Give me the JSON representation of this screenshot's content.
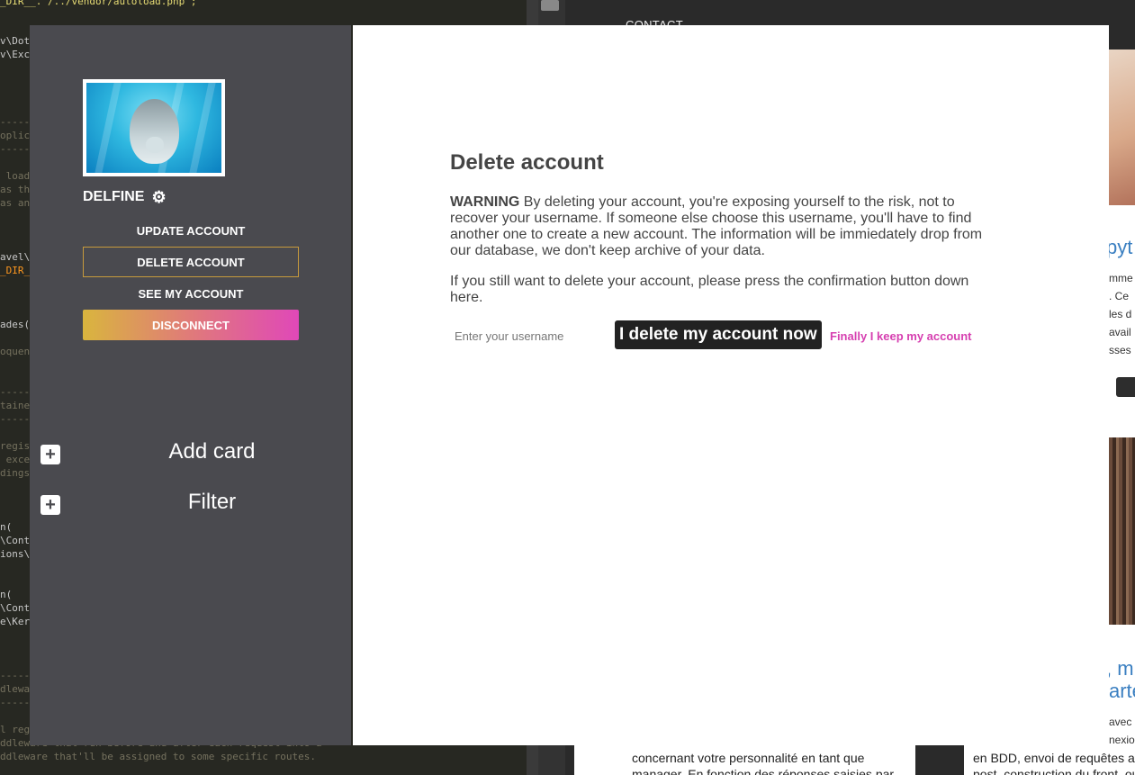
{
  "editor": {
    "lines": [
      {
        "text": "_DIR__.'/../vendor/autoload.php';",
        "cls": "str"
      },
      {
        "text": "v\\Dot",
        "cls": ""
      },
      {
        "text": "v\\Exc",
        "cls": ""
      },
      {
        "text": "------",
        "cls": "comment"
      },
      {
        "text": "oplic",
        "cls": "comment"
      },
      {
        "text": "------",
        "cls": "comment"
      },
      {
        "text": " load",
        "cls": "comment"
      },
      {
        "text": "as th",
        "cls": "comment"
      },
      {
        "text": "as an",
        "cls": "comment"
      },
      {
        "text": "avel\\",
        "cls": ""
      },
      {
        "text": "_DIR_",
        "cls": "orange"
      },
      {
        "text": "ades()",
        "cls": ""
      },
      {
        "text": "oquen",
        "cls": "comment"
      },
      {
        "text": "------",
        "cls": "comment"
      },
      {
        "text": "taine",
        "cls": "comment"
      },
      {
        "text": "------",
        "cls": "comment"
      },
      {
        "text": "regis",
        "cls": "comment"
      },
      {
        "text": " exce",
        "cls": "comment"
      },
      {
        "text": "dings",
        "cls": "comment"
      },
      {
        "text": "n(",
        "cls": ""
      },
      {
        "text": "\\Cont",
        "cls": ""
      },
      {
        "text": "ions\\",
        "cls": ""
      },
      {
        "text": "n(",
        "cls": ""
      },
      {
        "text": "\\Cont",
        "cls": ""
      },
      {
        "text": "e\\Ker",
        "cls": ""
      },
      {
        "text": "------",
        "cls": "comment"
      },
      {
        "text": "dlewa",
        "cls": "comment"
      },
      {
        "text": "------",
        "cls": "comment"
      },
      {
        "text": "l reg",
        "cls": "comment"
      },
      {
        "text": "ddleware that run before and after each request into a",
        "cls": "comment"
      },
      {
        "text": "ddleware that'll be assigned to some specific routes.",
        "cls": "comment"
      }
    ]
  },
  "background_site": {
    "nav_contact": "CONTACT",
    "frag_title_1": "pyt",
    "frag_small_lines_1": [
      "mme",
      ". Ce",
      "les d",
      "avail",
      "sses"
    ],
    "frag_title_2a": ", m",
    "frag_title_2b": "arte",
    "frag_small_lines_2": [
      "avec",
      "nexio"
    ],
    "bottom_card_1": [
      "concernant votre personnalité en tant que",
      "manager. En fonction des réponses saisies par"
    ],
    "bottom_card_2": [
      "en BDD, envoi de requêtes a",
      "post, construction du front, ou"
    ]
  },
  "sidebar": {
    "username": "DELFINE",
    "gear_icon": "gear-icon",
    "menu": {
      "update": "UPDATE ACCOUNT",
      "delete": "DELETE ACCOUNT",
      "see": "SEE MY ACCOUNT",
      "disconnect": "DISCONNECT"
    },
    "add_card": "Add card",
    "filter": "Filter",
    "plus_glyph": "+"
  },
  "modal": {
    "title": "Delete account",
    "warning_label": "WARNING",
    "warning_text": " By deleting your account, you're exposing yourself to the risk, not to recover your username. If someone else choose this username, you'll have to find another one to create a new account. The information will be immiedately drop from our database, we don't keep archive of your data.",
    "confirm_text": "If you still want to delete your account, please press the confirmation button down here.",
    "input_placeholder": "Enter your username",
    "input_value": "",
    "delete_button": "I delete my account now",
    "keep_link": "Finally I keep my account"
  },
  "colors": {
    "sidebar_bg": "#4a4a4f",
    "outline_gold": "#c79a3c",
    "link_pink": "#d63fb0",
    "gradient_start": "#d9b53e",
    "gradient_end": "#e048b8"
  }
}
